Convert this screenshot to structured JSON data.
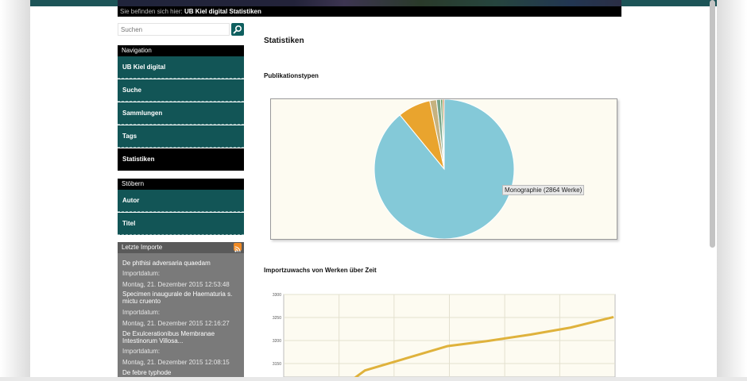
{
  "breadcrumb": {
    "prefix": "Sie befinden sich hier:",
    "current": "UB Kiel digital Statistiken"
  },
  "search": {
    "placeholder": "Suchen"
  },
  "navigation": {
    "title": "Navigation",
    "items": [
      {
        "label": "UB Kiel digital"
      },
      {
        "label": "Suche"
      },
      {
        "label": "Sammlungen"
      },
      {
        "label": "Tags"
      },
      {
        "label": "Statistiken",
        "active": true
      }
    ]
  },
  "browse": {
    "title": "Stöbern",
    "items": [
      {
        "label": "Autor"
      },
      {
        "label": "Titel"
      }
    ]
  },
  "imports": {
    "title": "Letzte Importe",
    "entries": [
      {
        "title": "De phthisi adversaria quaedam",
        "label": "Importdatum:",
        "date": "Montag, 21. Dezember 2015 12:53:48"
      },
      {
        "title": "Specimen inaugurale de Haematuria s. mictu cruento",
        "label": "Importdatum:",
        "date": "Montag, 21. Dezember 2015 12:16:27"
      },
      {
        "title": "De Exulcerationibus Membranae Intestinorum Villosa...",
        "label": "Importdatum:",
        "date": "Montag, 21. Dezember 2015 12:08:15"
      },
      {
        "title": "De febre typhode"
      }
    ]
  },
  "content": {
    "title": "Statistiken",
    "pie_section": "Publikationstypen",
    "pie_tooltip": "Monographie (2864 Werke)",
    "line_section": "Importzuwachs von Werken über Zeit"
  },
  "chart_data": [
    {
      "type": "pie",
      "slices": [
        {
          "value": 2864,
          "color": "#84c9d8"
        },
        {
          "value": 244,
          "color": "#e9a42e"
        },
        {
          "value": 50,
          "color": "#c6b27f"
        },
        {
          "value": 30,
          "color": "#76a387"
        },
        {
          "value": 15,
          "color": "#5f9e63"
        },
        {
          "value": 12,
          "color": "#d07c3b"
        }
      ]
    },
    {
      "type": "line",
      "color": "#dfb23c",
      "yticks": [
        3300,
        3250,
        3200,
        3150
      ],
      "ylim": [
        3125,
        3300
      ],
      "points": [
        [
          0.25,
          3135
        ],
        [
          0.5,
          3188
        ],
        [
          0.62,
          3199
        ],
        [
          0.75,
          3213
        ],
        [
          0.87,
          3228
        ],
        [
          1.0,
          3251
        ]
      ]
    }
  ]
}
